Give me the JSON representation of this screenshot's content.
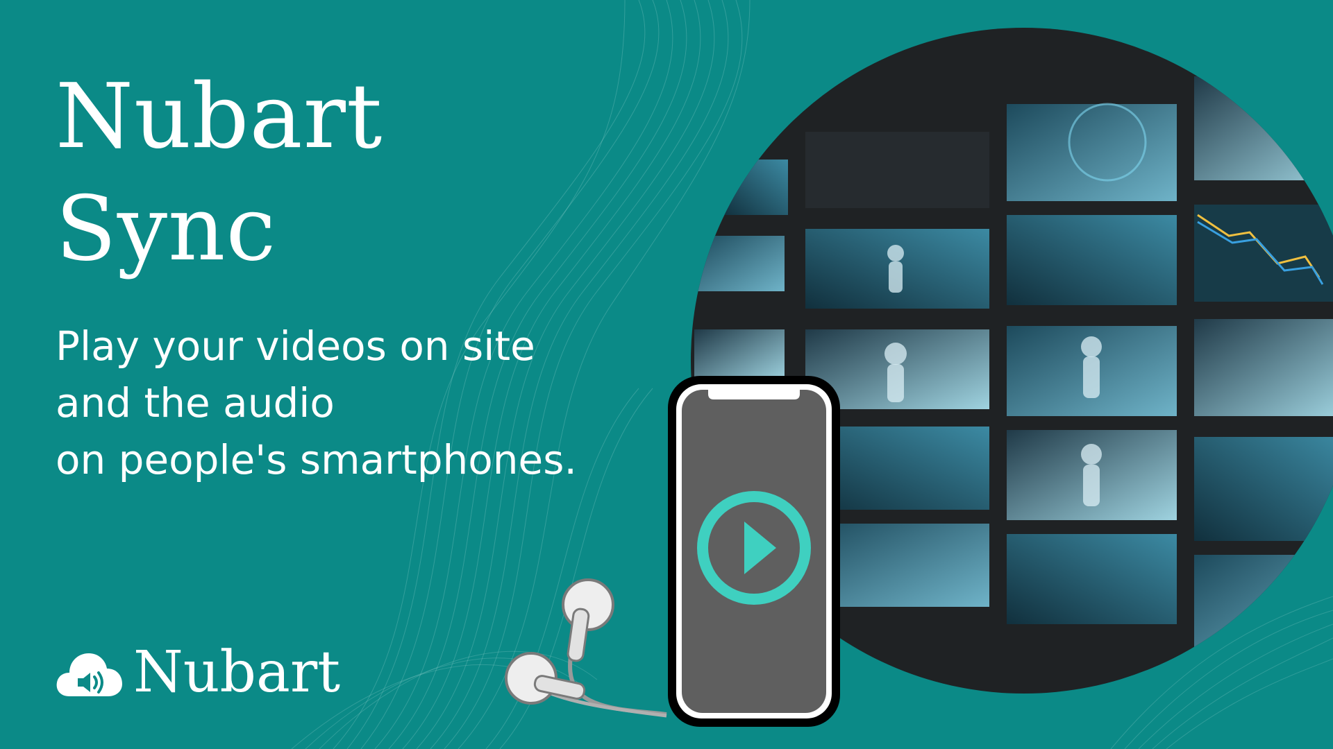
{
  "headline": {
    "line1": "Nubart",
    "line2": "Sync"
  },
  "tagline": {
    "line1": "Play your videos on site",
    "line2": "and the audio",
    "line3": "on people's smartphones."
  },
  "logo": {
    "text": "Nubart",
    "icon": "cloud-speaker-icon"
  },
  "phone": {
    "icon": "play-icon"
  },
  "colors": {
    "background": "#0b8a87",
    "accent": "#3fd0c0",
    "phone_screen": "#5f5f5f",
    "circle_dark": "#1f2224"
  }
}
